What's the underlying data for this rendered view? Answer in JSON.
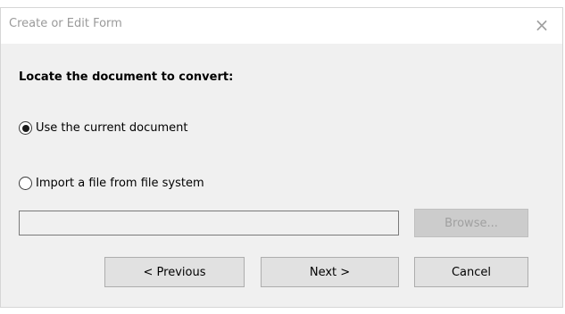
{
  "window": {
    "title": "Create or Edit Form",
    "close_glyph": "×"
  },
  "form": {
    "heading": "Locate the document to convert:",
    "options": [
      {
        "label": "Use the current document",
        "selected": true
      },
      {
        "label": "Import a file from file system",
        "selected": false
      }
    ],
    "file_path": {
      "value": "",
      "placeholder": ""
    },
    "browse_label": "Browse..."
  },
  "buttons": {
    "previous": "< Previous",
    "next": "Next >",
    "cancel": "Cancel"
  }
}
